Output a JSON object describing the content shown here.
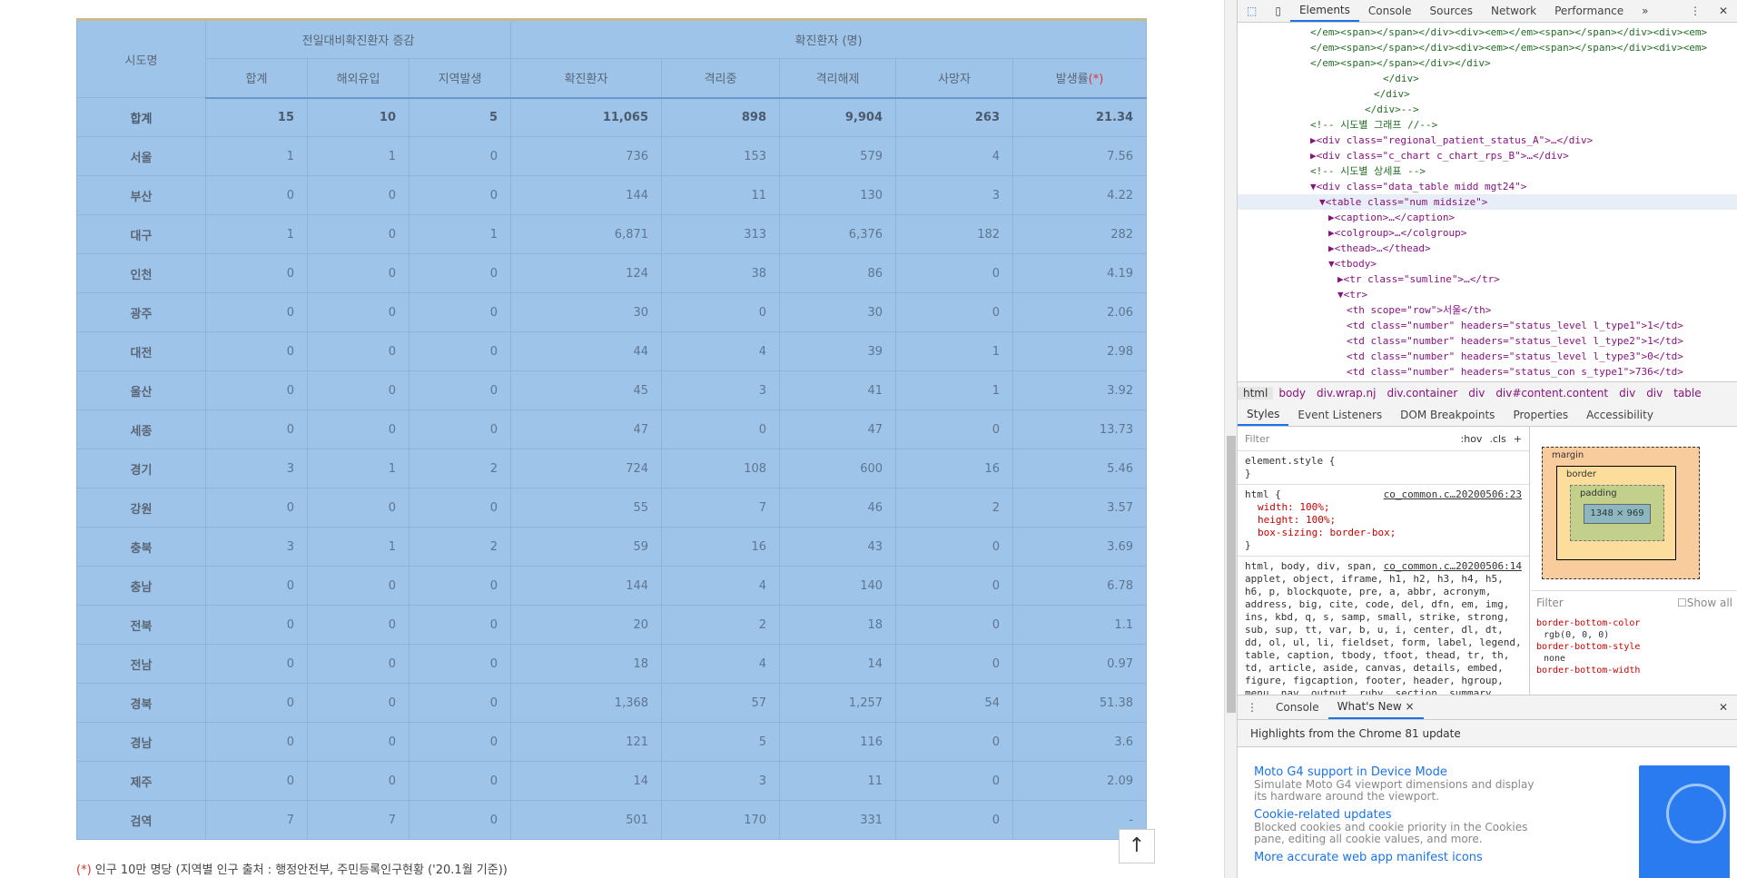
{
  "table": {
    "corner": "시도명",
    "group1": "전일대비확진환자 증감",
    "group2": "확진환자 (명)",
    "cols": [
      "합계",
      "해외유입",
      "지역발생",
      "확진환자",
      "격리중",
      "격리해제",
      "사망자",
      "발생률"
    ],
    "rate_mark": "(*)",
    "rows": [
      [
        "합계",
        "15",
        "10",
        "5",
        "11,065",
        "898",
        "9,904",
        "263",
        "21.34"
      ],
      [
        "서울",
        "1",
        "1",
        "0",
        "736",
        "153",
        "579",
        "4",
        "7.56"
      ],
      [
        "부산",
        "0",
        "0",
        "0",
        "144",
        "11",
        "130",
        "3",
        "4.22"
      ],
      [
        "대구",
        "1",
        "0",
        "1",
        "6,871",
        "313",
        "6,376",
        "182",
        "282"
      ],
      [
        "인천",
        "0",
        "0",
        "0",
        "124",
        "38",
        "86",
        "0",
        "4.19"
      ],
      [
        "광주",
        "0",
        "0",
        "0",
        "30",
        "0",
        "30",
        "0",
        "2.06"
      ],
      [
        "대전",
        "0",
        "0",
        "0",
        "44",
        "4",
        "39",
        "1",
        "2.98"
      ],
      [
        "울산",
        "0",
        "0",
        "0",
        "45",
        "3",
        "41",
        "1",
        "3.92"
      ],
      [
        "세종",
        "0",
        "0",
        "0",
        "47",
        "0",
        "47",
        "0",
        "13.73"
      ],
      [
        "경기",
        "3",
        "1",
        "2",
        "724",
        "108",
        "600",
        "16",
        "5.46"
      ],
      [
        "강원",
        "0",
        "0",
        "0",
        "55",
        "7",
        "46",
        "2",
        "3.57"
      ],
      [
        "충북",
        "3",
        "1",
        "2",
        "59",
        "16",
        "43",
        "0",
        "3.69"
      ],
      [
        "충남",
        "0",
        "0",
        "0",
        "144",
        "4",
        "140",
        "0",
        "6.78"
      ],
      [
        "전북",
        "0",
        "0",
        "0",
        "20",
        "2",
        "18",
        "0",
        "1.1"
      ],
      [
        "전남",
        "0",
        "0",
        "0",
        "18",
        "4",
        "14",
        "0",
        "0.97"
      ],
      [
        "경북",
        "0",
        "0",
        "0",
        "1,368",
        "57",
        "1,257",
        "54",
        "51.38"
      ],
      [
        "경남",
        "0",
        "0",
        "0",
        "121",
        "5",
        "116",
        "0",
        "3.6"
      ],
      [
        "제주",
        "0",
        "0",
        "0",
        "14",
        "3",
        "11",
        "0",
        "2.09"
      ],
      [
        "검역",
        "7",
        "7",
        "0",
        "501",
        "170",
        "331",
        "0",
        "-"
      ]
    ],
    "selection_color": "#9fc4e9"
  },
  "footnote": {
    "mark": "(*)",
    "text": " 인구 10만 명당 (지역별 인구 출처 : 행정안전부, 주민등록인구현황 ('20.1월 기준))"
  },
  "scroll_top_icon": "arrow-up-icon",
  "devtools": {
    "tabs": [
      "Elements",
      "Console",
      "Sources",
      "Network",
      "Performance",
      "»"
    ],
    "active_tab": "Elements",
    "dom_lines": [
      {
        "i": 0,
        "t": "</em><span></span></div><div><em></em><span></span></div><div><em>",
        "c": "cm"
      },
      {
        "i": 0,
        "t": "</em><span></span></div><div><em></em><span></span></div><div><em>",
        "c": "cm"
      },
      {
        "i": 0,
        "t": "</em><span></span></div></div>",
        "c": "cm"
      },
      {
        "i": 8,
        "t": "</div>",
        "c": "cm"
      },
      {
        "i": 7,
        "t": "</div>",
        "c": "cm"
      },
      {
        "i": 6,
        "t": "</div>-->",
        "c": "cm"
      },
      {
        "i": 0,
        "t": "<!-- 시도별 그래프 //-->",
        "c": "cm"
      },
      {
        "i": 0,
        "t": "▶<div class=\"regional_patient_status_A\">…</div>",
        "c": "tg"
      },
      {
        "i": 0,
        "t": "▶<div class=\"c_chart c_chart_rps_B\">…</div>",
        "c": "tg"
      },
      {
        "i": 0,
        "t": "<!-- 시도별 상세표 -->",
        "c": "cm"
      },
      {
        "i": 0,
        "t": "▼<div class=\"data_table midd mgt24\">",
        "c": "tg"
      },
      {
        "i": 1,
        "t": "▼<table class=\"num midsize\">",
        "c": "tg",
        "sel": true
      },
      {
        "i": 2,
        "t": "▶<caption>…</caption>",
        "c": "tg"
      },
      {
        "i": 2,
        "t": "▶<colgroup>…</colgroup>",
        "c": "tg"
      },
      {
        "i": 2,
        "t": "▶<thead>…</thead>",
        "c": "tg"
      },
      {
        "i": 2,
        "t": "▼<tbody>",
        "c": "tg"
      },
      {
        "i": 3,
        "t": "▶<tr class=\"sumline\">…</tr>",
        "c": "tg"
      },
      {
        "i": 3,
        "t": "▼<tr>",
        "c": "tg"
      },
      {
        "i": 4,
        "t": "<th scope=\"row\">서울</th>",
        "c": "tg"
      },
      {
        "i": 4,
        "t": "<td class=\"number\" headers=\"status_level l_type1\">1</td>",
        "c": "tg"
      },
      {
        "i": 4,
        "t": "<td class=\"number\" headers=\"status_level l_type2\">1</td>",
        "c": "tg"
      },
      {
        "i": 4,
        "t": "<td class=\"number\" headers=\"status_level l_type3\">0</td>",
        "c": "tg"
      },
      {
        "i": 4,
        "t": "<td class=\"number\" headers=\"status_con s_type1\">736</td>",
        "c": "tg"
      }
    ],
    "breadcrumb": [
      "html",
      "body",
      "div.wrap.nj",
      "div.container",
      "div",
      "div#content.content",
      "div",
      "div",
      "table"
    ],
    "style_tabs": [
      "Styles",
      "Event Listeners",
      "DOM Breakpoints",
      "Properties",
      "Accessibility"
    ],
    "filter_placeholder": "Filter",
    "hov": ":hov",
    "cls": ".cls",
    "rules": [
      {
        "sel": "element.style {",
        "src": "",
        "props": [],
        "close": "}"
      },
      {
        "sel": "html {",
        "src": "co_common.c…20200506:23",
        "props": [
          "width: 100%;",
          "height: 100%;",
          "box-sizing: border-box;"
        ],
        "close": "}"
      },
      {
        "sel": "html, body, div, span, applet, object, iframe, h1, h2, h3, h4, h5, h6, p, blockquote, pre, a, abbr, acronym, address, big, cite, code, del, dfn, em, img, ins, kbd, q, s, samp, small, strike, strong, sub, sup, tt, var, b, u, i, center, dl, dt, dd, ol, ul, li, fieldset, form, label, legend, table, caption, tbody, tfoot, thead, tr, th, td, article, aside, canvas, details, embed, figure, figcaption, footer, header, hgroup, menu, nav, output, ruby, section, summary, time, mark,",
        "src": "co_common.c…20200506:14",
        "props": [],
        "close": ""
      }
    ],
    "box": {
      "margin": "margin",
      "border": "border",
      "padding": "padding",
      "content": "1348 × 969",
      "dash": "–"
    },
    "computed_filter": "Filter",
    "show_all": "Show all",
    "computed": [
      [
        "border-bottom-color",
        "rgb(0, 0, 0)"
      ],
      [
        "border-bottom-style",
        "none"
      ],
      [
        "border-bottom-width",
        ""
      ]
    ],
    "drawer_tabs": [
      "Console",
      "What's New ×"
    ],
    "highlights": "Highlights from the Chrome 81 update",
    "news": [
      {
        "title": "Moto G4 support in Device Mode",
        "desc": "Simulate Moto G4 viewport dimensions and display its hardware around the viewport."
      },
      {
        "title": "Cookie-related updates",
        "desc": "Blocked cookies and cookie priority in the Cookies pane, editing all cookie values, and more."
      },
      {
        "title": "More accurate web app manifest icons",
        "desc": ""
      }
    ]
  }
}
